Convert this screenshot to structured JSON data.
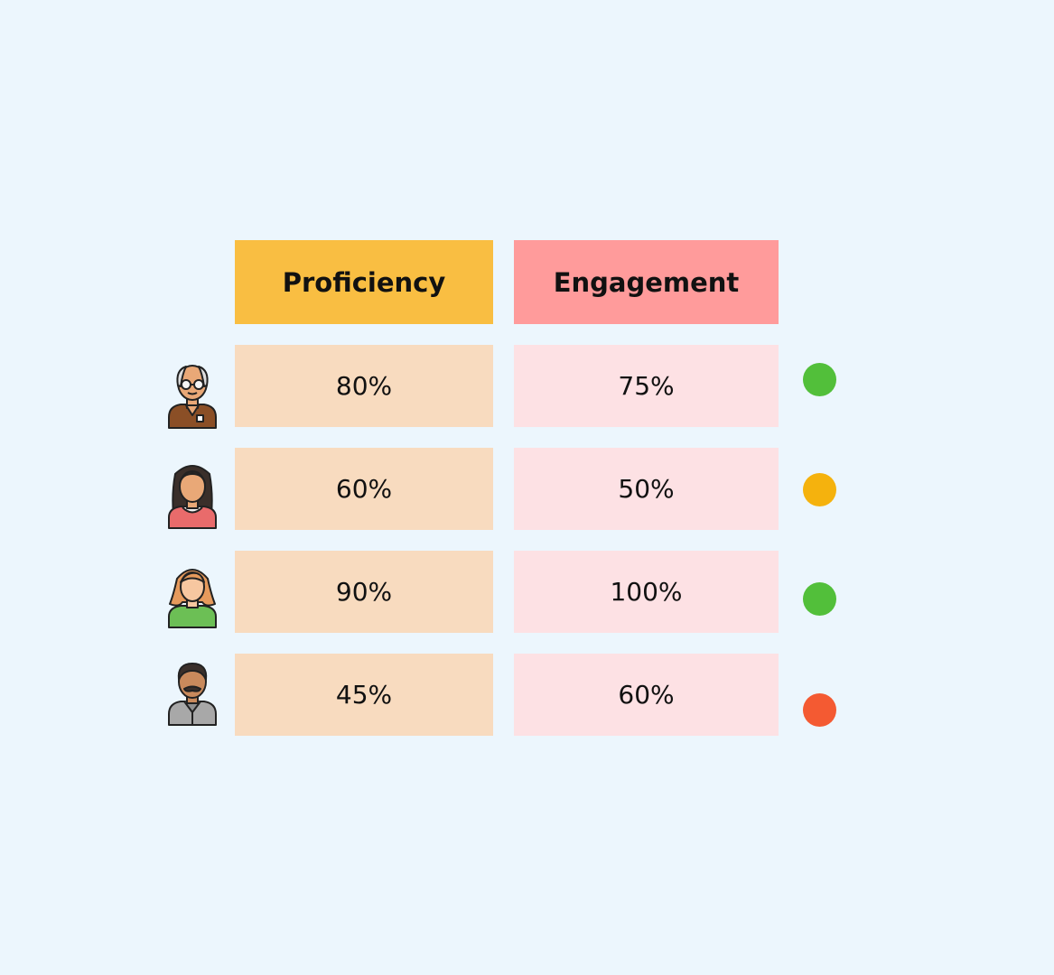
{
  "headers": {
    "proficiency": "Proficiency",
    "engagement": "Engagement"
  },
  "rows": [
    {
      "avatar": "elderly-man-glasses-icon",
      "proficiency": "80%",
      "engagement": "75%",
      "status_color": "#52BF3A"
    },
    {
      "avatar": "woman-dark-hair-icon",
      "proficiency": "60%",
      "engagement": "50%",
      "status_color": "#F5B20D"
    },
    {
      "avatar": "woman-ginger-hair-icon",
      "proficiency": "90%",
      "engagement": "100%",
      "status_color": "#52BF3A"
    },
    {
      "avatar": "man-mustache-icon",
      "proficiency": "45%",
      "engagement": "60%",
      "status_color": "#F45A32"
    }
  ],
  "colors": {
    "background": "#ECF6FD",
    "proficiency_header": "#F9BE42",
    "engagement_header": "#FF9B9B",
    "proficiency_cell": "#F8DBBF",
    "engagement_cell": "#FDE1E4"
  }
}
